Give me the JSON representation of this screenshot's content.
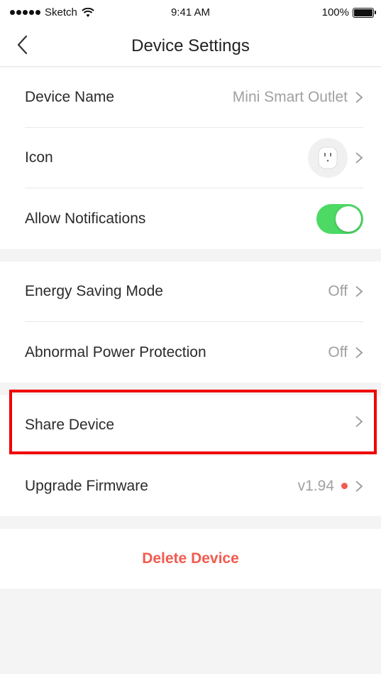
{
  "status_bar": {
    "carrier": "Sketch",
    "time": "9:41 AM",
    "battery": "100%"
  },
  "nav": {
    "title": "Device Settings"
  },
  "group1": [
    {
      "label": "Device Name",
      "value": "Mini Smart Outlet"
    },
    {
      "label": "Icon",
      "icon": "outlet-icon"
    },
    {
      "label": "Allow Notifications",
      "toggle": true
    }
  ],
  "group2": [
    {
      "label": "Energy Saving Mode",
      "value": "Off"
    },
    {
      "label": "Abnormal Power Protection",
      "value": "Off"
    }
  ],
  "group3": [
    {
      "label": "Share Device",
      "value": ""
    },
    {
      "label": "Upgrade Firmware",
      "value": "v1.94"
    }
  ],
  "delete_label": "Delete Device",
  "colors": {
    "toggle_on": "#4cd964",
    "danger": "#f25b4f",
    "highlight": "#f00000"
  }
}
